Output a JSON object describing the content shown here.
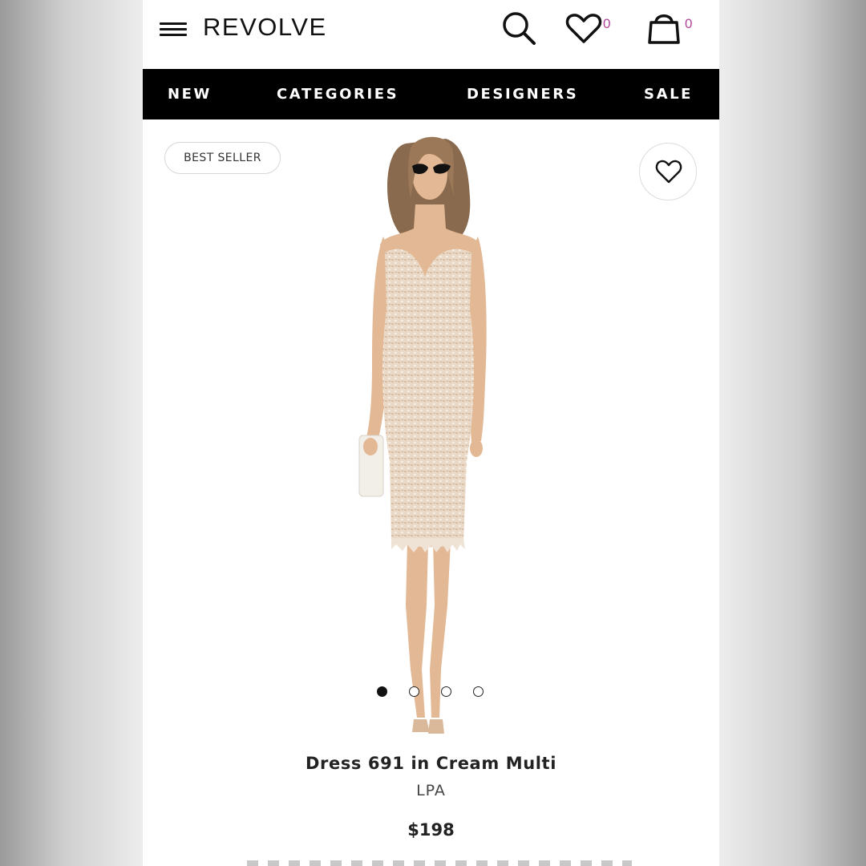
{
  "header": {
    "brand": "REVOLVE",
    "wishlist_count": "0",
    "bag_count": "0"
  },
  "nav": {
    "items": [
      "NEW",
      "CATEGORIES",
      "DESIGNERS",
      "SALE"
    ]
  },
  "product": {
    "badge": "BEST SELLER",
    "title": "Dress 691 in Cream Multi",
    "brand": "LPA",
    "price": "$198",
    "image_count": 4,
    "active_image_index": 0
  },
  "colors": {
    "nav_bg": "#000000",
    "count_accent": "#b0459b",
    "dress": "#e8d6c4",
    "skin": "#e3b894"
  },
  "icons": {
    "menu": "hamburger-menu-icon",
    "search": "search-icon",
    "wishlist": "heart-icon",
    "bag": "shopping-bag-icon"
  }
}
